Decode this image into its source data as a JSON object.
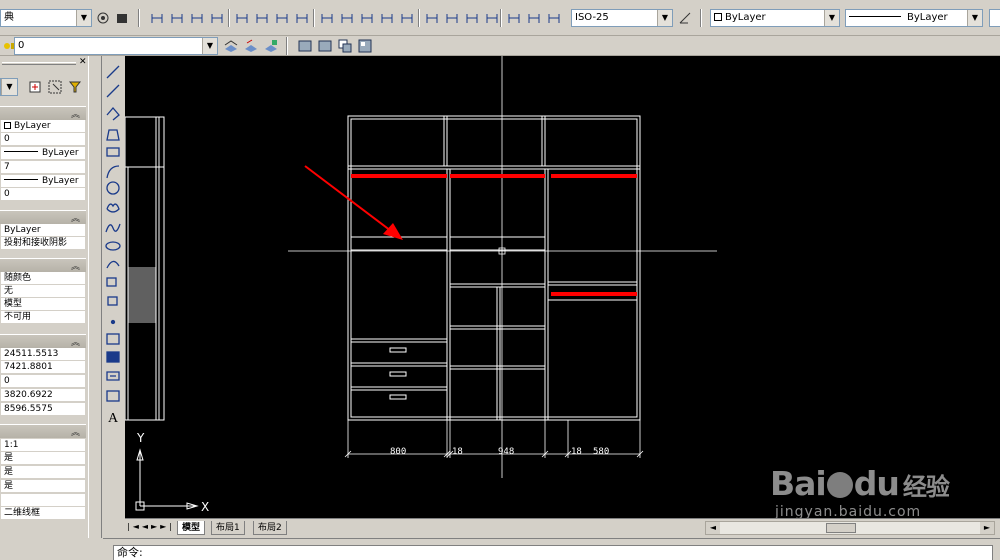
{
  "toolbar_top": {
    "workspace_combo": "典",
    "dimstyle_combo": "ISO-25",
    "color_combo": "ByLayer",
    "linetype_combo": "ByLayer"
  },
  "toolbar_second": {
    "layer_combo": "0"
  },
  "palette": {
    "general": {
      "color": "ByLayer",
      "layer": "0",
      "linetype": "ByLayer",
      "linetype_scale": "7",
      "lineweight": "ByLayer",
      "thickness": "0"
    },
    "material": {
      "material": "ByLayer",
      "shadow": "投射和接收阴影"
    },
    "plot": {
      "plot_style": "随颜色",
      "plot_style_name": "无",
      "plot_table": "模型",
      "plot_attached": "不可用"
    },
    "view": {
      "center_x": "24511.5513",
      "center_y": "7421.8801",
      "center_z": "0",
      "height": "3820.6922",
      "width": "8596.5575"
    },
    "misc": {
      "annotation_scale": "1:1",
      "ucs_icon_on": "是",
      "ucs_icon_origin": "是",
      "ucs_per_viewport": "是",
      "visual_style": "二维线框"
    }
  },
  "drawing": {
    "dims": [
      "800",
      "18",
      "948",
      "18",
      "580"
    ],
    "axis_y": "Y",
    "axis_x": "X"
  },
  "tabs": [
    "模型",
    "布局1",
    "布局2"
  ],
  "command": {
    "prompt": "命令:"
  },
  "watermark": {
    "brand": "Bai",
    "brand2": "du",
    "cn": "经验",
    "url": "jingyan.baidu.com"
  },
  "colors": {
    "canvas": "#000000",
    "lines": "#ffffff",
    "highlight": "#ff0000",
    "chrome": "#d4d0c8"
  }
}
